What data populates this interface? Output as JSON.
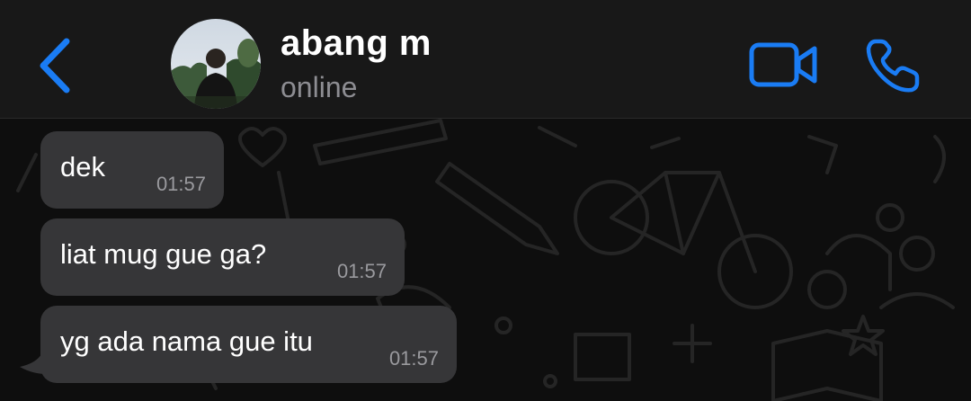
{
  "header": {
    "back_icon": "chevron-left-icon",
    "contact_name": "abang m",
    "contact_status": "online",
    "video_icon": "video-camera-icon",
    "call_icon": "phone-icon",
    "accent_color": "#1a7cf4"
  },
  "messages": [
    {
      "text": "dek",
      "time": "01:57",
      "direction": "incoming"
    },
    {
      "text": "liat mug gue ga?",
      "time": "01:57",
      "direction": "incoming"
    },
    {
      "text": "yg ada nama gue itu",
      "time": "01:57",
      "direction": "incoming"
    }
  ],
  "colors": {
    "header_bg": "#181818",
    "chat_bg": "#0e0e0e",
    "bubble_bg": "#363638",
    "status_gray": "#8d8d92"
  }
}
